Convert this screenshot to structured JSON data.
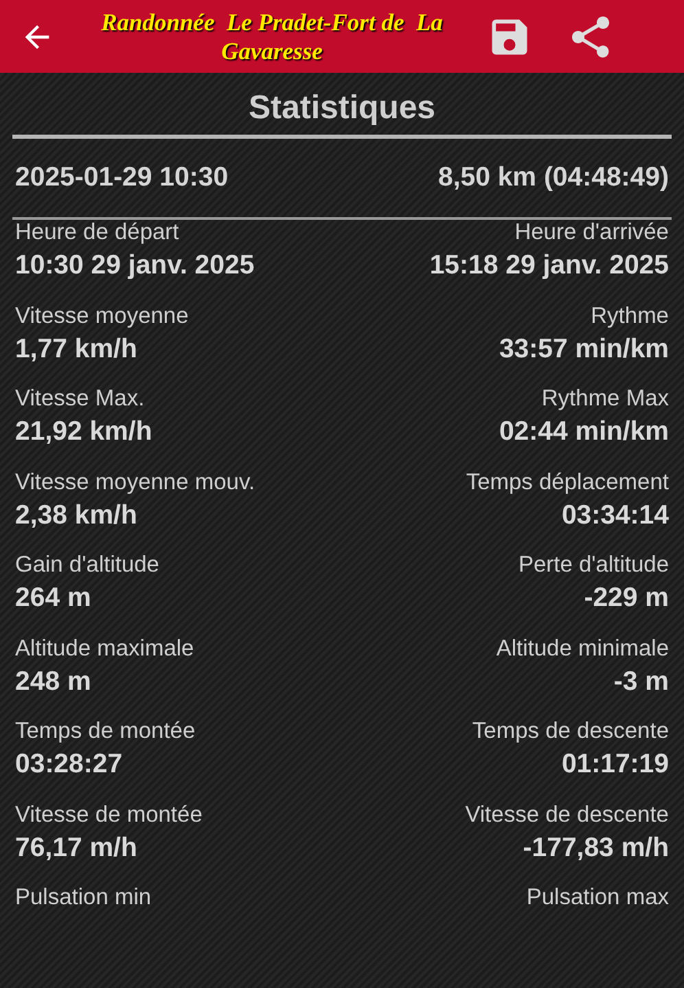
{
  "app_bar": {
    "title": "Randonnée  Le Pradet-Fort de  La Gavaresse"
  },
  "heading": "Statistiques",
  "summary": {
    "date": "2025-01-29 10:30",
    "distance": "8,50 km (04:48:49)"
  },
  "stats": [
    {
      "left": {
        "label": "Heure de départ",
        "value": "10:30 29 janv. 2025"
      },
      "right": {
        "label": "Heure d'arrivée",
        "value": "15:18 29 janv. 2025"
      }
    },
    {
      "left": {
        "label": "Vitesse moyenne",
        "value": "1,77 km/h"
      },
      "right": {
        "label": "Rythme",
        "value": "33:57 min/km"
      }
    },
    {
      "left": {
        "label": "Vitesse Max.",
        "value": "21,92 km/h"
      },
      "right": {
        "label": "Rythme Max",
        "value": "02:44 min/km"
      }
    },
    {
      "left": {
        "label": "Vitesse moyenne mouv.",
        "value": "2,38 km/h"
      },
      "right": {
        "label": "Temps déplacement",
        "value": "03:34:14"
      }
    },
    {
      "left": {
        "label": "Gain d'altitude",
        "value": "264 m"
      },
      "right": {
        "label": "Perte d'altitude",
        "value": "-229 m"
      }
    },
    {
      "left": {
        "label": "Altitude maximale",
        "value": "248 m"
      },
      "right": {
        "label": "Altitude minimale",
        "value": "-3 m"
      }
    },
    {
      "left": {
        "label": "Temps de montée",
        "value": "03:28:27"
      },
      "right": {
        "label": "Temps de descente",
        "value": "01:17:19"
      }
    },
    {
      "left": {
        "label": "Vitesse de montée",
        "value": "76,17 m/h"
      },
      "right": {
        "label": "Vitesse de descente",
        "value": "-177,83 m/h"
      }
    },
    {
      "left": {
        "label": "Pulsation min"
      },
      "right": {
        "label": "Pulsation max"
      }
    }
  ]
}
